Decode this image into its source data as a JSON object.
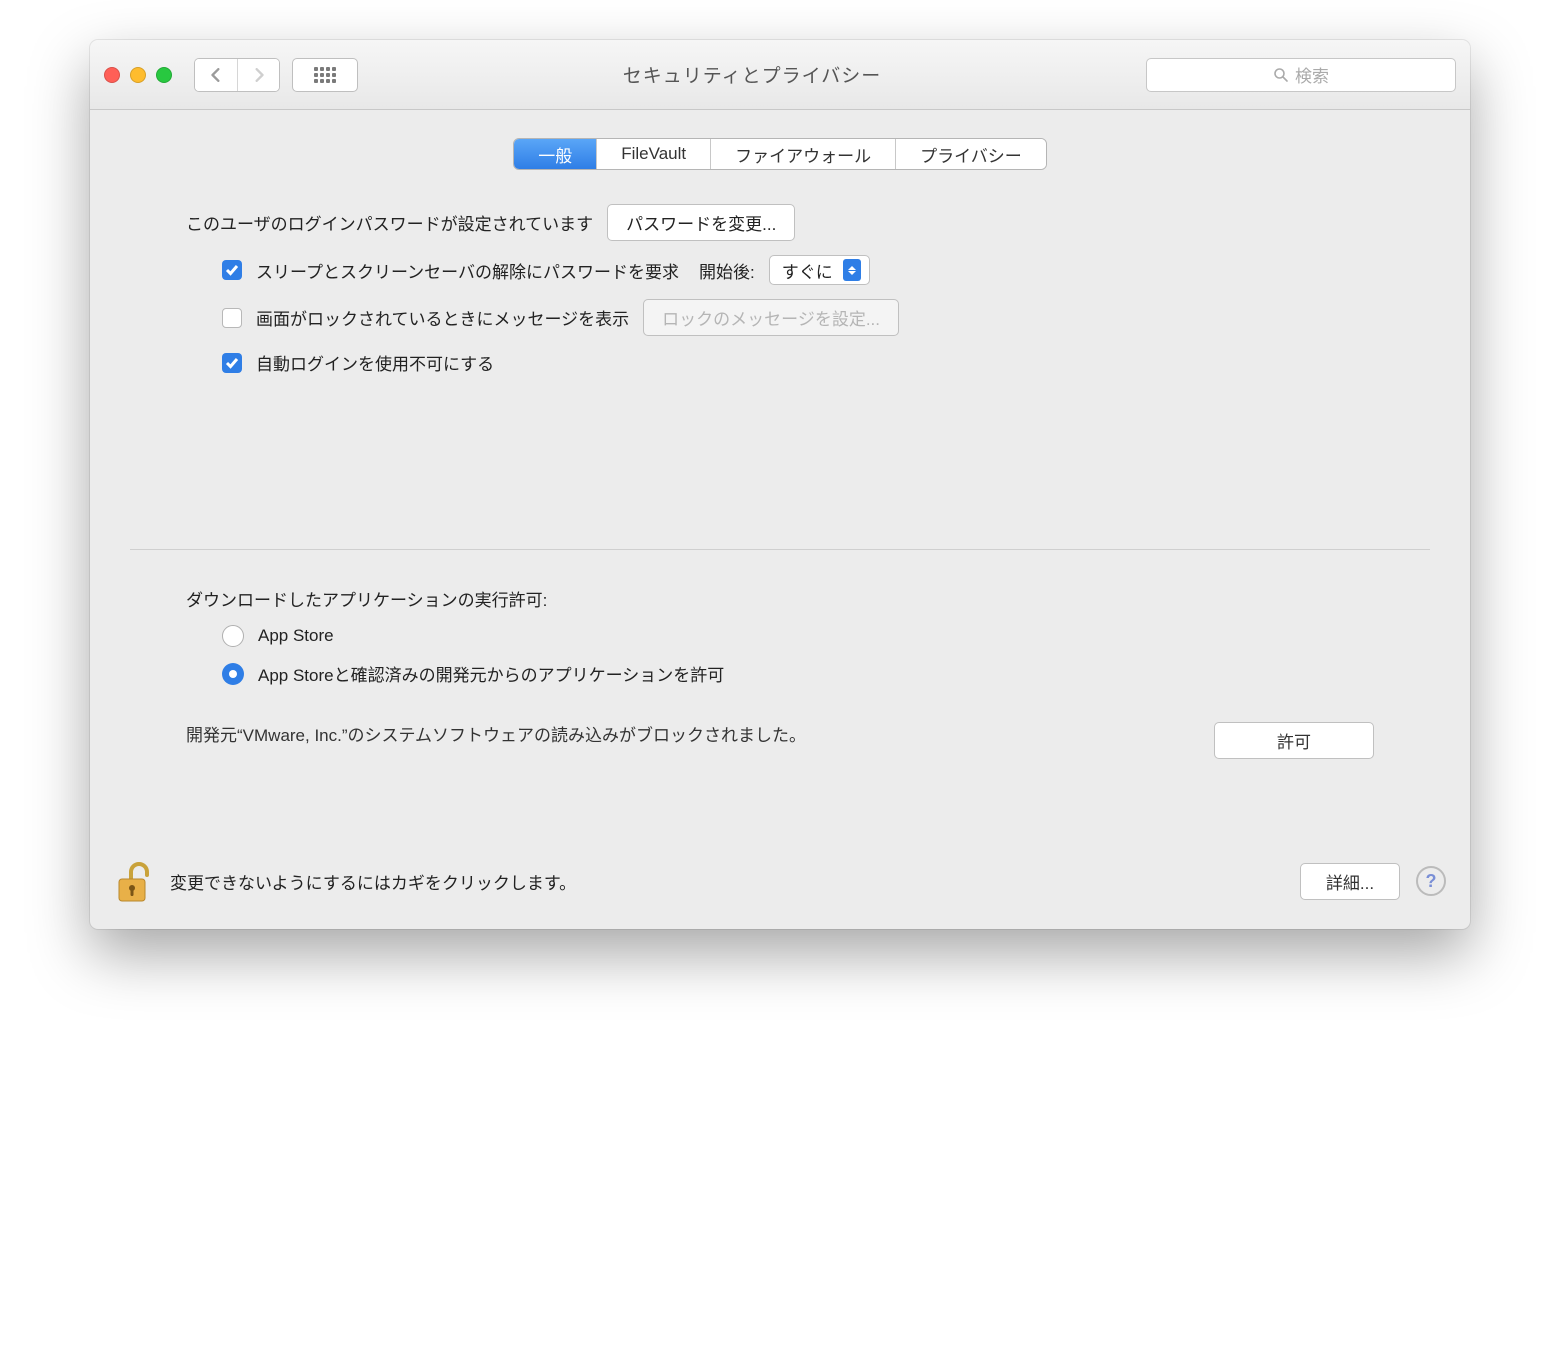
{
  "window": {
    "title": "セキュリティとプライバシー",
    "search_placeholder": "検索"
  },
  "tabs": {
    "general": "一般",
    "filevault": "FileVault",
    "firewall": "ファイアウォール",
    "privacy": "プライバシー"
  },
  "general": {
    "password_set_label": "このユーザのログインパスワードが設定されています",
    "change_password_btn": "パスワードを変更...",
    "require_password_label": "スリープとスクリーンセーバの解除にパスワードを要求",
    "after_label": "開始後:",
    "delay_value": "すぐに",
    "show_message_label": "画面がロックされているときにメッセージを表示",
    "set_lock_message_btn": "ロックのメッセージを設定...",
    "disable_autologin_label": "自動ログインを使用不可にする",
    "allow_apps_heading": "ダウンロードしたアプリケーションの実行許可:",
    "radio_appstore": "App Store",
    "radio_identified": "App Storeと確認済みの開発元からのアプリケーションを許可",
    "blocked_message": "開発元“VMware, Inc.”のシステムソフトウェアの読み込みがブロックされました。",
    "allow_btn": "許可"
  },
  "footer": {
    "lock_message": "変更できないようにするにはカギをクリックします。",
    "advanced_btn": "詳細...",
    "help": "?"
  }
}
